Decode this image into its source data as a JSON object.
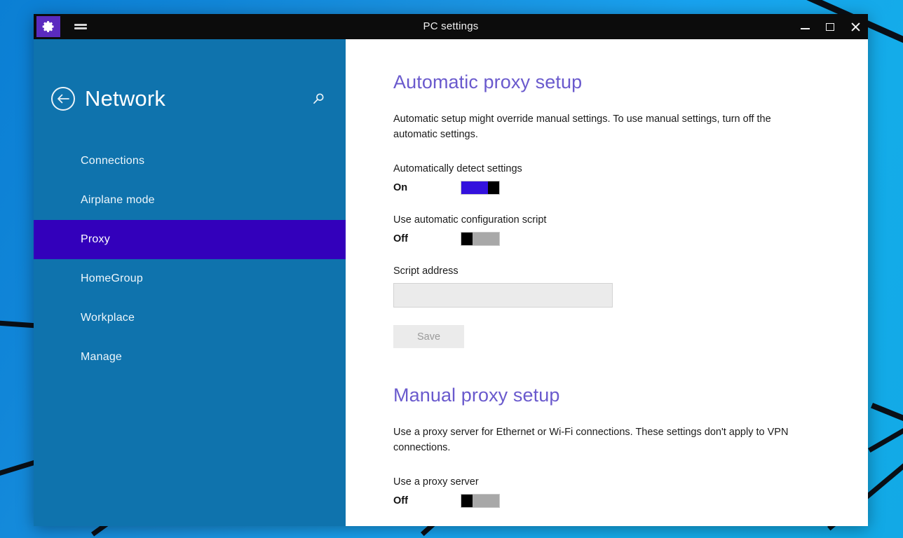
{
  "window": {
    "title": "PC settings",
    "app_icon": "gear-icon",
    "menu_icon": "hamburger-menu-icon",
    "controls": {
      "minimize": "minimize-icon",
      "maximize": "maximize-icon",
      "close": "close-icon"
    }
  },
  "sidebar": {
    "back_icon": "back-arrow-circle-icon",
    "title": "Network",
    "search_icon": "search-icon",
    "items": [
      {
        "label": "Connections",
        "selected": false
      },
      {
        "label": "Airplane mode",
        "selected": false
      },
      {
        "label": "Proxy",
        "selected": true
      },
      {
        "label": "HomeGroup",
        "selected": false
      },
      {
        "label": "Workplace",
        "selected": false
      },
      {
        "label": "Manage",
        "selected": false
      }
    ]
  },
  "content": {
    "automatic": {
      "heading": "Automatic proxy setup",
      "description": "Automatic setup might override manual settings. To use manual settings, turn off the automatic settings.",
      "detect_settings": {
        "label": "Automatically detect settings",
        "state": "On"
      },
      "config_script": {
        "label": "Use automatic configuration script",
        "state": "Off"
      },
      "script_address": {
        "label": "Script address",
        "value": "",
        "placeholder": ""
      },
      "save_label": "Save"
    },
    "manual": {
      "heading": "Manual proxy setup",
      "description": "Use a proxy server for Ethernet or Wi-Fi connections. These settings don't apply to VPN connections.",
      "use_proxy": {
        "label": "Use a proxy server",
        "state": "Off"
      }
    }
  },
  "colors": {
    "accent_purple": "#3300bb",
    "heading_purple": "#6a5acd",
    "sidebar_blue": "#0f73ad",
    "toggle_on": "#3311dd",
    "toggle_off": "#a8a8a8",
    "titlebar": "#0c0c0c"
  }
}
